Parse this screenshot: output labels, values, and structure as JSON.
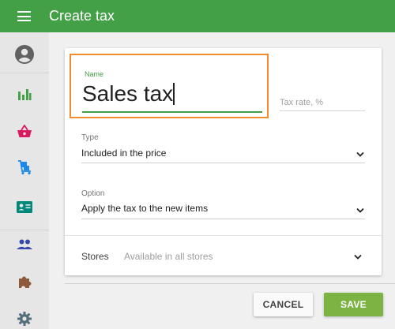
{
  "header": {
    "title": "Create tax"
  },
  "sidebar": {
    "items": [
      {
        "icon": "account-circle-icon"
      },
      {
        "icon": "bar-chart-icon"
      },
      {
        "icon": "shopping-basket-icon"
      },
      {
        "icon": "inventory-cart-icon"
      },
      {
        "icon": "id-card-icon"
      },
      {
        "icon": "people-icon"
      },
      {
        "icon": "puzzle-icon"
      },
      {
        "icon": "gear-icon"
      }
    ]
  },
  "form": {
    "name_label": "Name",
    "name_value": "Sales tax",
    "tax_rate_placeholder": "Tax rate, %",
    "type_label": "Type",
    "type_value": "Included in the price",
    "option_label": "Option",
    "option_value": "Apply the tax to the new items",
    "stores_label": "Stores",
    "stores_value": "Available in all stores"
  },
  "buttons": {
    "cancel": "CANCEL",
    "save": "SAVE"
  },
  "colors": {
    "header": "#43a047",
    "accent": "#43a047",
    "highlight": "#f28b30",
    "save": "#7cb342",
    "basket": "#d81b60",
    "cart": "#1e88e5",
    "card_icon": "#00897b",
    "people": "#3949ab",
    "puzzle": "#8d5a3c",
    "gear": "#546e7a",
    "account": "#616161"
  }
}
